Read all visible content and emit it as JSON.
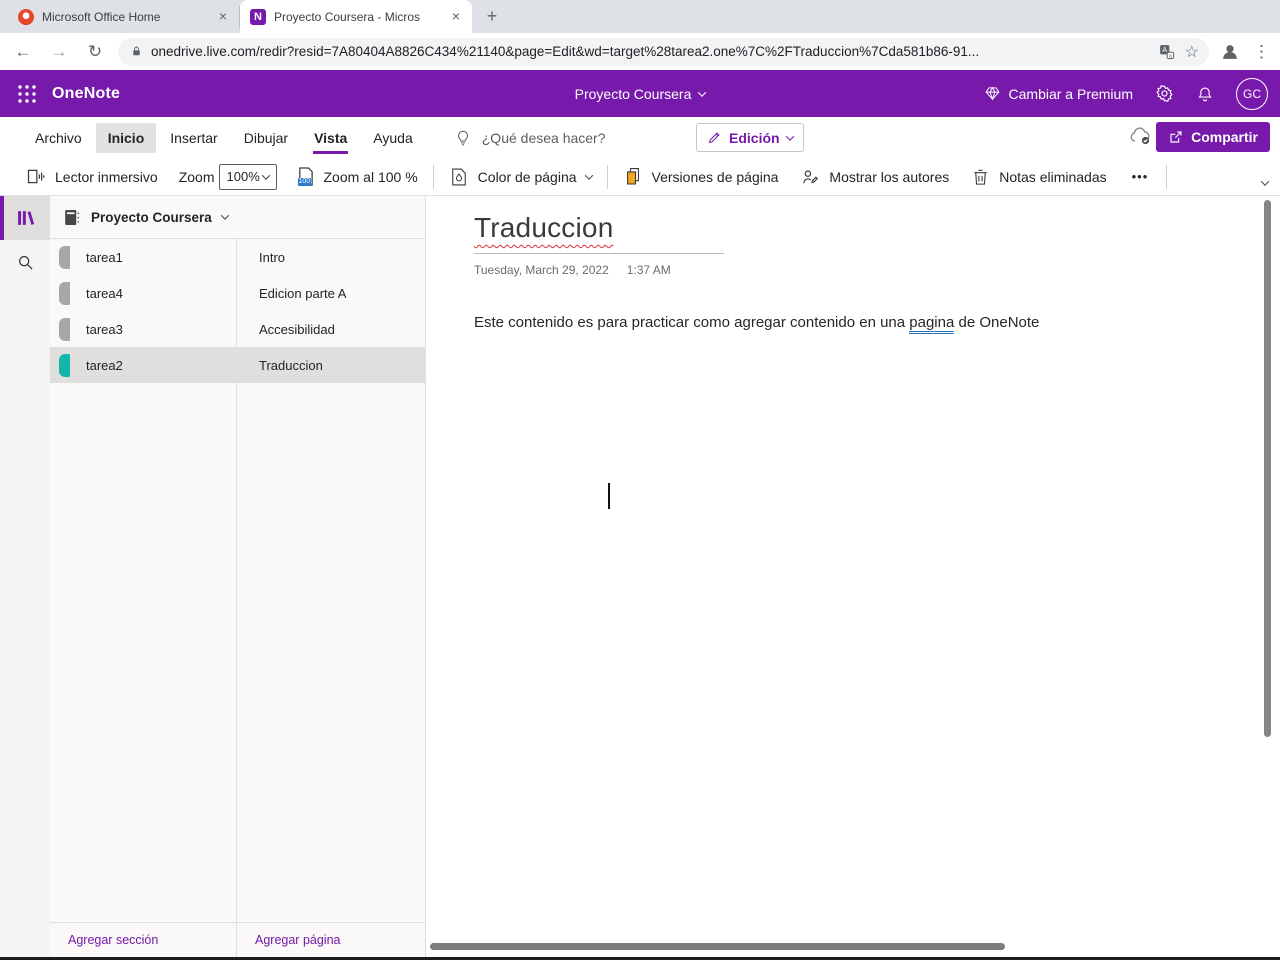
{
  "browser": {
    "tabs": [
      {
        "title": "Microsoft Office Home"
      },
      {
        "title": "Proyecto Coursera - Micros"
      }
    ],
    "url": "onedrive.live.com/redir?resid=7A80404A8826C434%21140&page=Edit&wd=target%28tarea2.one%7C%2FTraduccion%7Cda581b86-91...",
    "icons": {
      "close": "×",
      "new_tab": "+",
      "back": "←",
      "forward": "→",
      "reload": "↻",
      "star": "☆",
      "menu": "⋮"
    }
  },
  "header": {
    "app_name": "OneNote",
    "notebook_title": "Proyecto Coursera",
    "premium_label": "Cambiar a Premium",
    "avatar_initials": "GC"
  },
  "ribbon": {
    "tabs": [
      {
        "label": "Archivo"
      },
      {
        "label": "Inicio"
      },
      {
        "label": "Insertar"
      },
      {
        "label": "Dibujar"
      },
      {
        "label": "Vista"
      },
      {
        "label": "Ayuda"
      }
    ],
    "tell_me_label": "¿Qué desea hacer?",
    "edit_button_label": "Edición",
    "share_button_label": "Compartir"
  },
  "toolbar": {
    "immersive_reader_label": "Lector inmersivo",
    "zoom_label": "Zoom",
    "zoom_value": "100%",
    "zoom_badge": "100",
    "zoom_100_label": "Zoom al 100 %",
    "page_color_label": "Color de página",
    "page_versions_label": "Versiones de página",
    "show_authors_label": "Mostrar los autores",
    "deleted_notes_label": "Notas eliminadas",
    "more_label": "•••"
  },
  "sidebar": {
    "notebook_title": "Proyecto Coursera",
    "sections": [
      {
        "name": "tarea1",
        "color": "#a9a7a5"
      },
      {
        "name": "tarea4",
        "color": "#a9a7a5"
      },
      {
        "name": "tarea3",
        "color": "#a9a7a5"
      },
      {
        "name": "tarea2",
        "color": "#15b5a9"
      }
    ],
    "pages": [
      {
        "title": "Intro"
      },
      {
        "title": "Edicion parte A"
      },
      {
        "title": "Accesibilidad"
      },
      {
        "title": "Traduccion"
      }
    ],
    "add_section_label": "Agregar sección",
    "add_page_label": "Agregar página"
  },
  "page": {
    "title": "Traduccion",
    "date": "Tuesday, March 29, 2022",
    "time": "1:37 AM",
    "body_text_start": "Este contenido es para practicar como agregar contenido en una ",
    "body_text_underlined": "pagina",
    "body_text_end": " de OneNote"
  },
  "colors": {
    "brand_purple": "#7719aa",
    "selected_row_bg": "#e1dfdd",
    "section_teal": "#15b5a9",
    "section_gray": "#a9a7a5"
  }
}
